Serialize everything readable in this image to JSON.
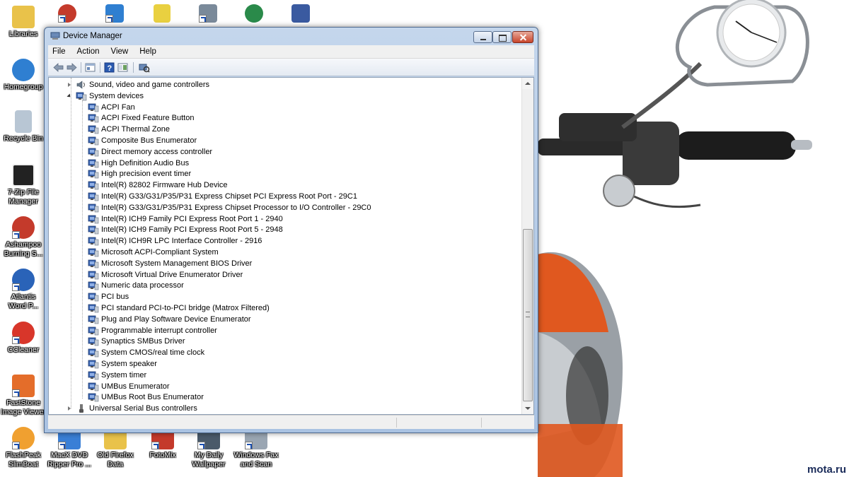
{
  "desktop": {
    "icons": [
      {
        "label": "Libraries",
        "color": "#e9c24a"
      },
      {
        "label": "Homegroup",
        "color": "#2f7fd1"
      },
      {
        "label": "Recycle Bin",
        "color": "#b8c6d4"
      },
      {
        "label": "7-Zip File Manager",
        "color": "#222222"
      },
      {
        "label": "Ashampoo Burning S...",
        "color": "#c43a2b"
      },
      {
        "label": "Atlantis Word P...",
        "color": "#2a63b8"
      },
      {
        "label": "CCleaner",
        "color": "#d8362a"
      },
      {
        "label": "FastStone Image Viewer",
        "color": "#e46d2a"
      },
      {
        "label": "FlashPeak SlimBoat",
        "color": "#f0a030"
      },
      {
        "label": "MacX DVD Ripper Pro ...",
        "color": "#3a7fd6"
      },
      {
        "label": "Old Firefox Data",
        "color": "#e9c24a"
      },
      {
        "label": "FotoMix",
        "color": "#c43a2b"
      },
      {
        "label": "My Daily Wallpaper",
        "color": "#4a5a6a"
      },
      {
        "label": "Windows Fax and Scan",
        "color": "#9aa6b3"
      }
    ],
    "watermark": "mota.ru"
  },
  "window": {
    "title": "Device Manager",
    "menu": [
      "File",
      "Action",
      "View",
      "Help"
    ]
  },
  "tree": {
    "categories_before": [
      {
        "label": "Sound, video and game controllers"
      }
    ],
    "system_devices": {
      "label": "System devices",
      "devices": [
        "ACPI Fan",
        "ACPI Fixed Feature Button",
        "ACPI Thermal Zone",
        "Composite Bus Enumerator",
        "Direct memory access controller",
        "High Definition Audio Bus",
        "High precision event timer",
        "Intel(R) 82802 Firmware Hub Device",
        "Intel(R) G33/G31/P35/P31 Express Chipset PCI Express Root Port - 29C1",
        "Intel(R) G33/G31/P35/P31 Express Chipset Processor to I/O Controller - 29C0",
        "Intel(R) ICH9 Family PCI Express Root Port 1 - 2940",
        "Intel(R) ICH9 Family PCI Express Root Port 5 - 2948",
        "Intel(R) ICH9R LPC Interface Controller - 2916",
        "Microsoft ACPI-Compliant System",
        "Microsoft System Management BIOS Driver",
        "Microsoft Virtual Drive Enumerator Driver",
        "Numeric data processor",
        "PCI bus",
        "PCI standard PCI-to-PCI bridge (Matrox Filtered)",
        "Plug and Play Software Device Enumerator",
        "Programmable interrupt controller",
        "Synaptics SMBus Driver",
        "System CMOS/real time clock",
        "System speaker",
        "System timer",
        "UMBus Enumerator",
        "UMBus Root Bus Enumerator"
      ]
    },
    "categories_after": [
      {
        "label": "Universal Serial Bus controllers"
      }
    ]
  }
}
